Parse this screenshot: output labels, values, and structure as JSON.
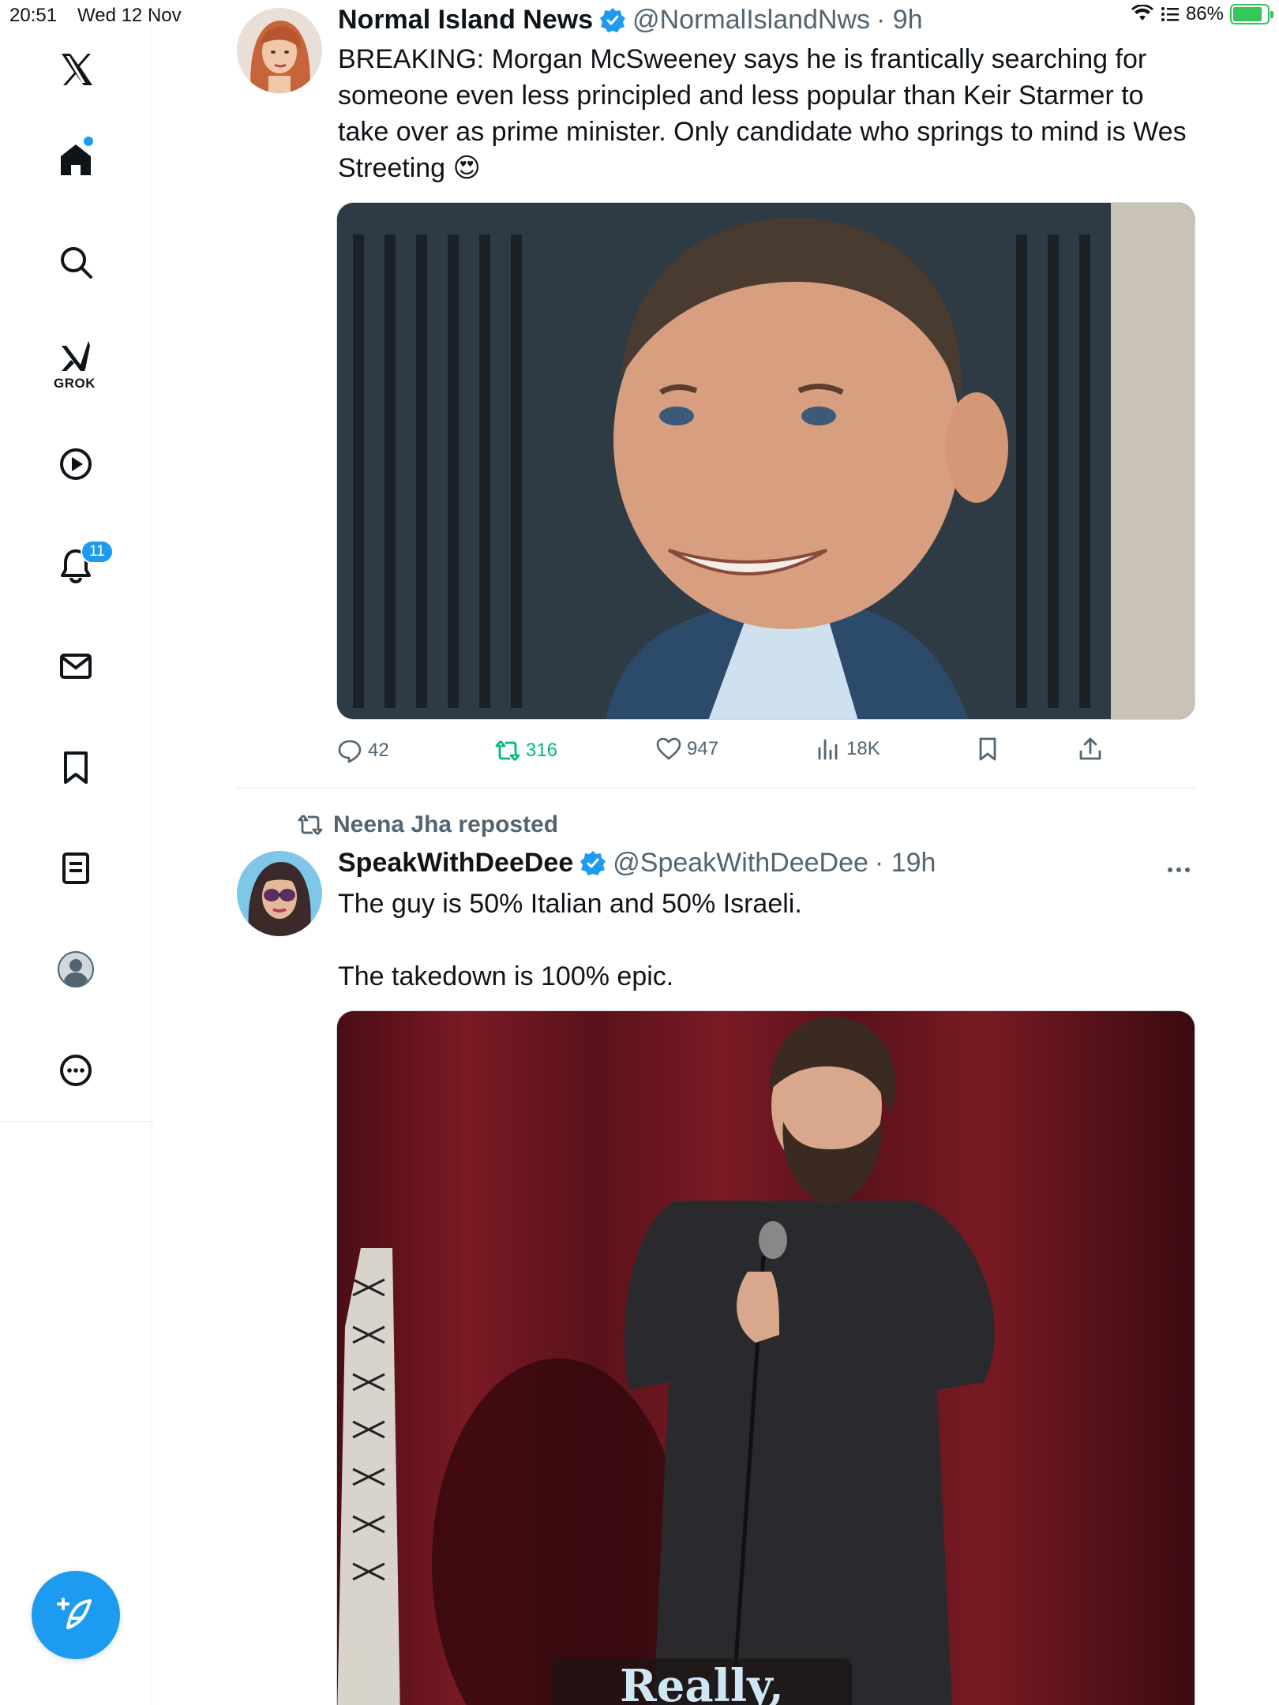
{
  "status_bar": {
    "time": "20:51",
    "date": "Wed 12 Nov",
    "battery": "86%"
  },
  "sidebar": {
    "grok_label": "GROK",
    "notifications_badge": "11"
  },
  "tweets": [
    {
      "display_name": "Normal Island News",
      "handle": "@NormalIslandNws",
      "time": "· 9h",
      "text": "BREAKING: Morgan McSweeney says he is frantically searching for someone even less principled and less popular than Keir Starmer to take over as prime minister. Only candidate who springs to mind is Wes Streeting 😍",
      "replies": "42",
      "reposts": "316",
      "likes": "947",
      "views": "18K"
    },
    {
      "reposted_by": "Neena Jha reposted",
      "display_name": "SpeakWithDeeDee",
      "handle": "@SpeakWithDeeDee",
      "time": "· 19h",
      "text_line1": "The guy is 50% Italian and 50% Israeli.",
      "text_line2": "The takedown is 100% epic.",
      "video_caption": "Really,"
    }
  ],
  "colors": {
    "accent": "#1d9bf0",
    "repost_green": "#00ba7c",
    "muted": "#536471"
  }
}
